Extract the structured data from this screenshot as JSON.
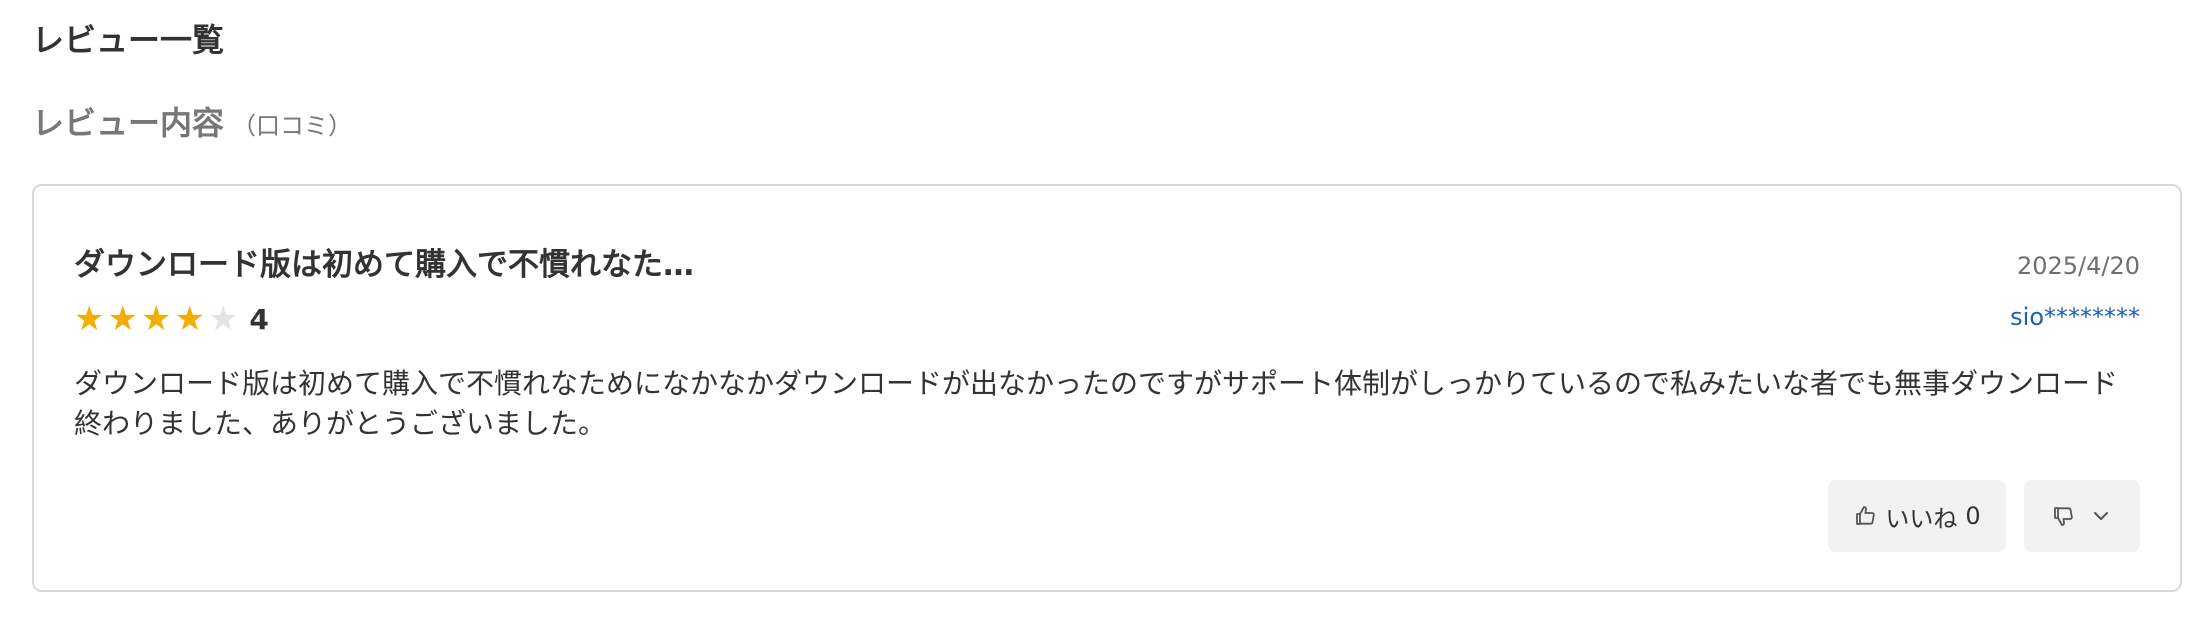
{
  "page": {
    "section_title": "レビュー一覧",
    "subsection_title": "レビュー内容",
    "subsection_note": "（口コミ）"
  },
  "review": {
    "title": "ダウンロード版は初めて購入で不慣れなた…",
    "date": "2025/4/20",
    "rating": {
      "value": "4",
      "filled_stars": 4,
      "max_stars": 5,
      "accent_color": "#f2ad00",
      "empty_color": "#e4e4e4"
    },
    "reviewer": "sio********",
    "body": "ダウンロード版は初めて購入で不慣れなためになかなかダウンロードが出なかったのですがサポート体制がしっかりているので私みたいな者でも無事ダウンロード終わりました、ありがとうございました。",
    "actions": {
      "like_label": "いいね",
      "like_count": "0",
      "like_icon": "thumb-up-icon",
      "dislike_icon": "thumb-down-icon",
      "menu_icon": "chevron-down-icon"
    }
  },
  "colors": {
    "text": "#333333",
    "muted_text": "#777777",
    "link": "#1f5fb8",
    "border": "#d9d9d9",
    "button_background": "#f2f2f2"
  }
}
